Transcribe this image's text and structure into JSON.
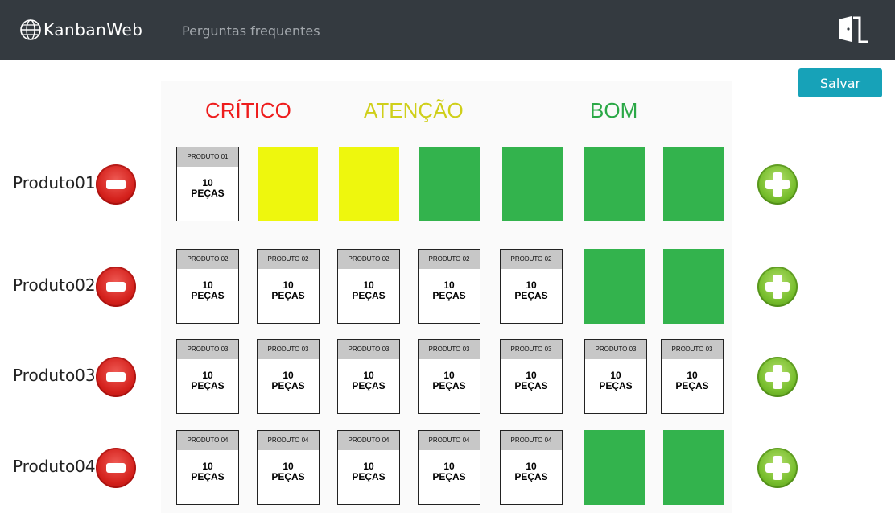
{
  "nav": {
    "brand": "KanbanWeb",
    "link": "Perguntas frequentes"
  },
  "actions": {
    "save": "Salvar"
  },
  "statuses": [
    {
      "label": "CRÍTICO",
      "color": "#ee1c1c"
    },
    {
      "label": "ATENÇÃO",
      "color": "#cfcf1a"
    },
    {
      "label": "BOM",
      "color": "#2aa846"
    }
  ],
  "slot_colors": [
    "#ff0000",
    "#eef70d",
    "#eef70d",
    "#33b34d",
    "#33b34d",
    "#33b34d",
    "#33b34d"
  ],
  "card_text": {
    "qty": "10",
    "unit": "PEÇAS"
  },
  "rows": [
    {
      "name": "Produto01",
      "code": "PRODUTO 01",
      "cards": 1
    },
    {
      "name": "Produto02",
      "code": "PRODUTO 02",
      "cards": 5
    },
    {
      "name": "Produto03",
      "code": "PRODUTO 03",
      "cards": 7
    },
    {
      "name": "Produto04",
      "code": "PRODUTO 04",
      "cards": 5
    }
  ]
}
